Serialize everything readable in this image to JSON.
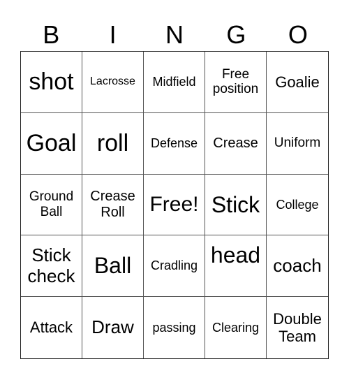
{
  "header": [
    "B",
    "I",
    "N",
    "G",
    "O"
  ],
  "cells": [
    [
      "shot",
      "Lacrosse",
      "Midfield",
      "Free position",
      "Goalie"
    ],
    [
      "Goal",
      "roll",
      "Defense",
      "Crease",
      "Uniform"
    ],
    [
      "Ground Ball",
      "Crease Roll",
      "Free!",
      "Stick",
      "College"
    ],
    [
      "Stick check",
      "Ball",
      "Cradling",
      "head",
      "coach"
    ],
    [
      "Attack",
      "Draw",
      "passing",
      "Clearing",
      "Double Team"
    ]
  ]
}
